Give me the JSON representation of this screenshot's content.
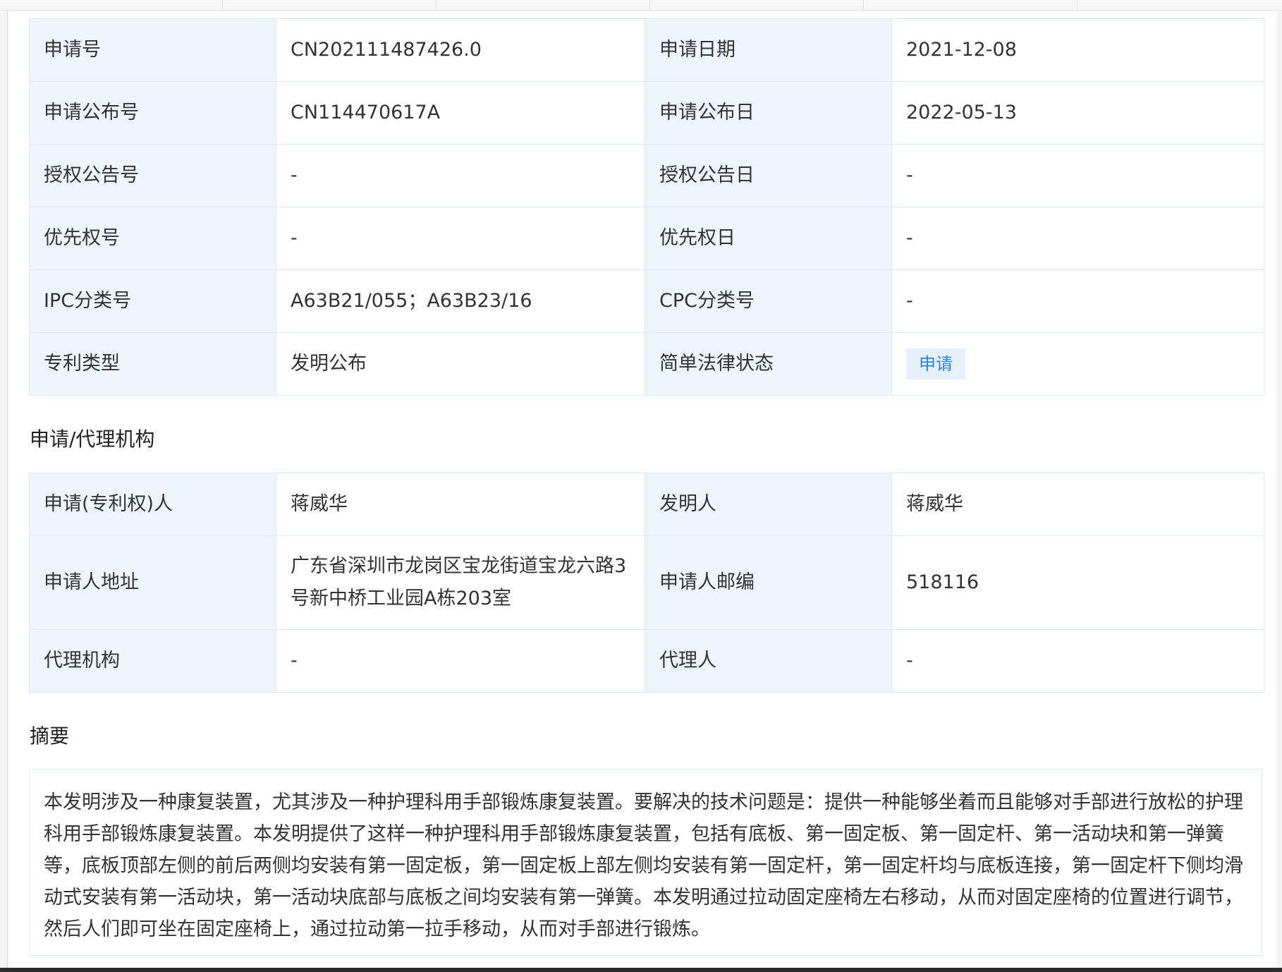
{
  "basic_info": [
    {
      "label_1": "申请号",
      "value_1": "CN202111487426.0",
      "label_2": "申请日期",
      "value_2": "2021-12-08"
    },
    {
      "label_1": "申请公布号",
      "value_1": "CN114470617A",
      "label_2": "申请公布日",
      "value_2": "2022-05-13"
    },
    {
      "label_1": "授权公告号",
      "value_1": "-",
      "label_2": "授权公告日",
      "value_2": "-"
    },
    {
      "label_1": "优先权号",
      "value_1": "-",
      "label_2": "优先权日",
      "value_2": "-"
    },
    {
      "label_1": "IPC分类号",
      "value_1": "A63B21/055；A63B23/16",
      "label_2": "CPC分类号",
      "value_2": "-"
    },
    {
      "label_1": "专利类型",
      "value_1": "发明公布",
      "label_2": "简单法律状态",
      "value_2": "申请"
    }
  ],
  "agency_section": {
    "title": "申请/代理机构",
    "rows": [
      {
        "label_1": "申请(专利权)人",
        "value_1": "蒋威华",
        "label_2": "发明人",
        "value_2": "蒋威华"
      },
      {
        "label_1": "申请人地址",
        "value_1": "广东省深圳市龙岗区宝龙街道宝龙六路3号新中桥工业园A栋203室",
        "label_2": "申请人邮编",
        "value_2": "518116"
      },
      {
        "label_1": "代理机构",
        "value_1": "-",
        "label_2": "代理人",
        "value_2": "-"
      }
    ]
  },
  "abstract_section": {
    "title": "摘要",
    "text": "本发明涉及一种康复装置，尤其涉及一种护理科用手部锻炼康复装置。要解决的技术问题是：提供一种能够坐着而且能够对手部进行放松的护理科用手部锻炼康复装置。本发明提供了这样一种护理科用手部锻炼康复装置，包括有底板、第一固定板、第一固定杆、第一活动块和第一弹簧等，底板顶部左侧的前后两侧均安装有第一固定板，第一固定板上部左侧均安装有第一固定杆，第一固定杆均与底板连接，第一固定杆下侧均滑动式安装有第一活动块，第一活动块底部与底板之间均安装有第一弹簧。本发明通过拉动固定座椅左右移动，从而对固定座椅的位置进行调节，然后人们即可坐在固定座椅上，通过拉动第一拉手移动，从而对手部进行锻炼。"
  },
  "colors": {
    "label_bg": "#eef5fd",
    "border": "#dfe9f5",
    "tag_bg": "#e6f1fd",
    "tag_text": "#2c85e0"
  }
}
